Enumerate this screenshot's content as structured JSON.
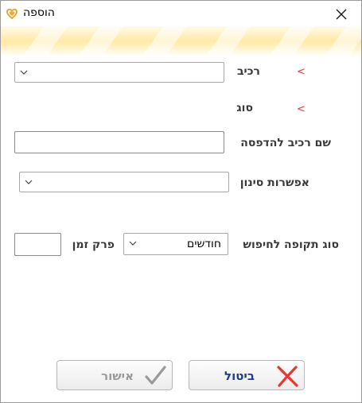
{
  "window": {
    "title": "הוספה"
  },
  "form": {
    "vehicle": {
      "label": "רכיב",
      "required_mark": "<",
      "value": ""
    },
    "type": {
      "label": "סוג",
      "required_mark": "<"
    },
    "print_name": {
      "label": "שם רכיב להדפסה",
      "value": ""
    },
    "filter_option": {
      "label": "אפשרות סינון",
      "value": ""
    },
    "period_type": {
      "label": "סוג תקופה לחיפוש",
      "value": "חודשים"
    },
    "time_span": {
      "label": "פרק זמן",
      "value": ""
    }
  },
  "buttons": {
    "confirm_label": "אישור",
    "cancel_label": "ביטול"
  },
  "colors": {
    "required_mark": "#e8372e",
    "cancel_label": "#1f3f8a",
    "confirm_label": "#9a9a9a",
    "cancel_icon": "#e8372e",
    "confirm_icon": "#9a9a9a"
  },
  "icons": {
    "app": "heart-logo-icon",
    "close": "close-icon",
    "dropdown": "chevron-down-icon",
    "confirm": "checkmark-icon",
    "cancel": "x-icon"
  }
}
